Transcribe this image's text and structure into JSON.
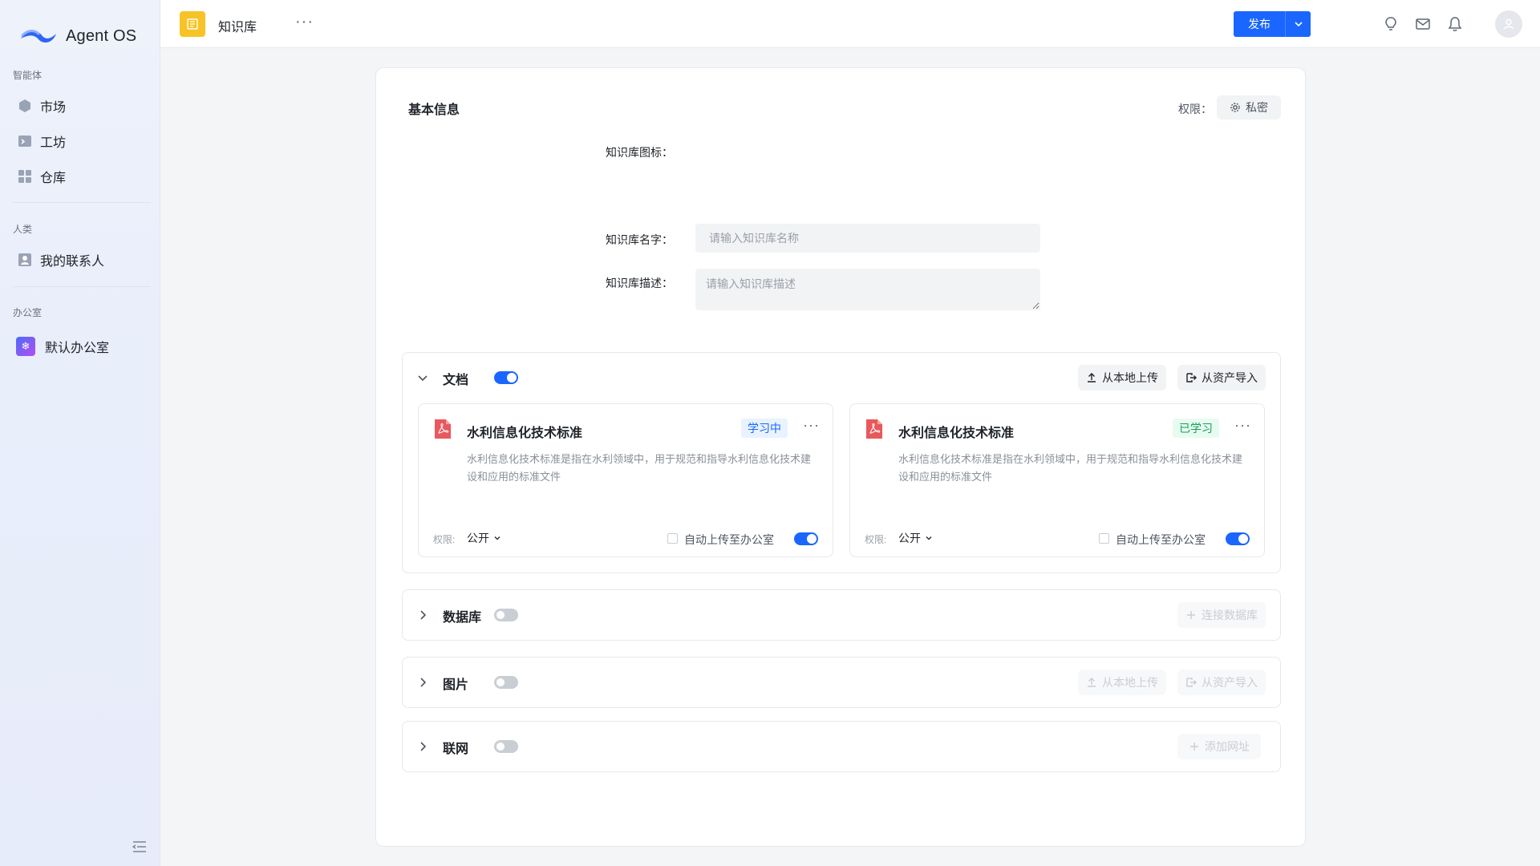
{
  "sidebar": {
    "logo_text": "Agent OS",
    "sections": [
      {
        "title": "智能体",
        "items": [
          {
            "label": "市场",
            "icon": "market-icon"
          },
          {
            "label": "工坊",
            "icon": "workshop-icon"
          },
          {
            "label": "仓库",
            "icon": "warehouse-icon"
          }
        ]
      },
      {
        "title": "人类",
        "items": [
          {
            "label": "我的联系人",
            "icon": "contacts-icon"
          }
        ]
      },
      {
        "title": "办公室",
        "items": [
          {
            "label": "默认办公室",
            "icon": "office-icon"
          }
        ]
      }
    ]
  },
  "header": {
    "title": "知识库",
    "publish_label": "发布"
  },
  "basic": {
    "title": "基本信息",
    "perm_label": "权限：",
    "perm_value": "私密",
    "icon_label": "知识库图标：",
    "name_label": "知识库名字：",
    "name_placeholder": "请输入知识库名称",
    "desc_label": "知识库描述：",
    "desc_placeholder": "请输入知识库描述"
  },
  "documents": {
    "title": "文档",
    "enabled": true,
    "upload_local": "从本地上传",
    "import_assets": "从资产导入",
    "cards": [
      {
        "title": "水利信息化技术标准",
        "status": "学习中",
        "desc": "水利信息化技术标准是指在水利领域中，用于规范和指导水利信息化技术建设和应用的标准文件",
        "perm_label": "权限:",
        "perm_value": "公开",
        "auto_upload": "自动上传至办公室",
        "auto_enabled": true
      },
      {
        "title": "水利信息化技术标准",
        "status": "已学习",
        "desc": "水利信息化技术标准是指在水利领域中，用于规范和指导水利信息化技术建设和应用的标准文件",
        "perm_label": "权限:",
        "perm_value": "公开",
        "auto_upload": "自动上传至办公室",
        "auto_enabled": true
      }
    ]
  },
  "database": {
    "title": "数据库",
    "enabled": false,
    "connect": "连接数据库"
  },
  "images": {
    "title": "图片",
    "enabled": false,
    "upload_local": "从本地上传",
    "import_assets": "从资产导入"
  },
  "web": {
    "title": "联网",
    "enabled": false,
    "add_url": "添加网址"
  },
  "colors": {
    "accent": "#1a66ff",
    "learning": "#1a66ff",
    "learned": "#12a35a",
    "kb_icon": "#f7c325"
  }
}
